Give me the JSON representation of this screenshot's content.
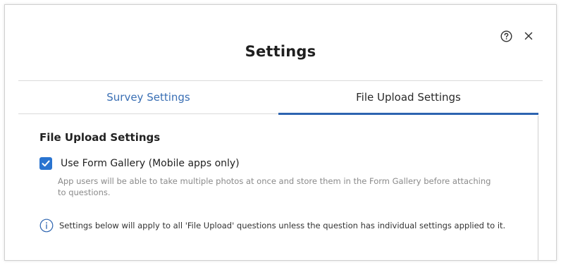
{
  "dialog": {
    "title": "Settings",
    "help_icon": "help-circle-icon",
    "close_icon": "close-icon"
  },
  "tabs": [
    {
      "label": "Survey Settings",
      "active": false
    },
    {
      "label": "File Upload Settings",
      "active": true
    }
  ],
  "file_upload": {
    "section_title": "File Upload Settings",
    "form_gallery": {
      "label": "Use Form Gallery (Mobile apps only)",
      "checked": true,
      "helper": "App users will be able to take multiple photos at once and store them in the Form Gallery before attaching to questions."
    },
    "info_note": "Settings below will apply to all 'File Upload' questions unless the question has individual settings applied to it."
  },
  "colors": {
    "accent": "#2d64b0",
    "checkbox": "#2a74d0",
    "link": "#3a6fb4"
  }
}
